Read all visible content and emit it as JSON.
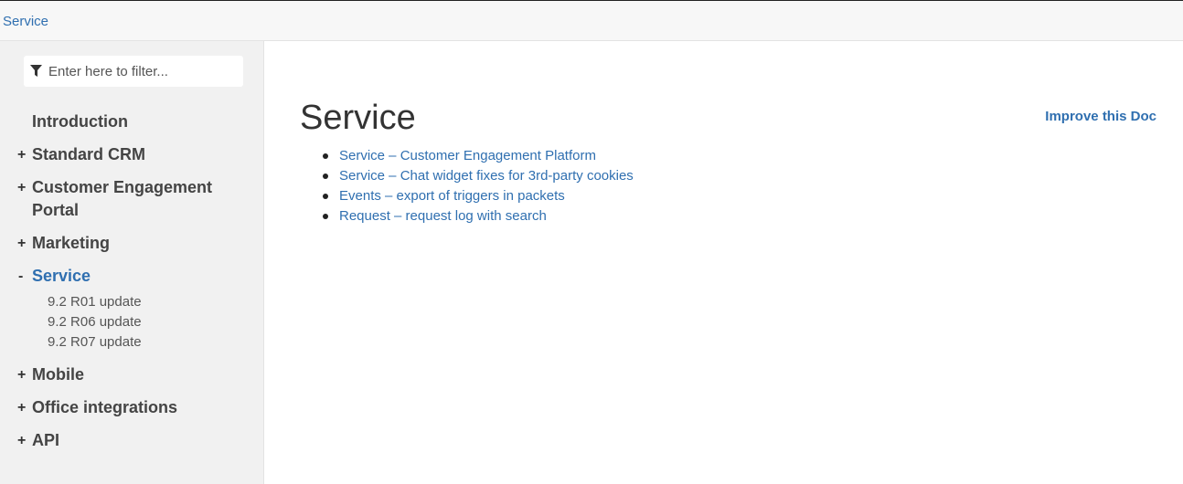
{
  "topbar": {
    "breadcrumb": "Service"
  },
  "sidebar": {
    "filter_placeholder": "Enter here to filter...",
    "items": [
      {
        "label": "Introduction",
        "toggle": ""
      },
      {
        "label": "Standard CRM",
        "toggle": "+"
      },
      {
        "label": "Customer Engagement Portal",
        "toggle": "+"
      },
      {
        "label": "Marketing",
        "toggle": "+"
      },
      {
        "label": "Service",
        "toggle": "-"
      },
      {
        "label": "Mobile",
        "toggle": "+"
      },
      {
        "label": "Office integrations",
        "toggle": "+"
      },
      {
        "label": "API",
        "toggle": "+"
      }
    ],
    "service_subitems": [
      {
        "label": "9.2 R01 update"
      },
      {
        "label": "9.2 R06 update"
      },
      {
        "label": "9.2 R07 update"
      }
    ]
  },
  "main": {
    "title": "Service",
    "improve_link": "Improve this Doc",
    "links": [
      {
        "label": "Service – Customer Engagement Platform"
      },
      {
        "label": "Service – Chat widget fixes for 3rd-party cookies"
      },
      {
        "label": "Events – export of triggers in packets"
      },
      {
        "label": "Request – request log with search"
      }
    ]
  },
  "colors": {
    "link": "#2f6fb0",
    "sidebar_bg": "#f1f1f1",
    "topbar_bg": "#f7f7f7"
  }
}
